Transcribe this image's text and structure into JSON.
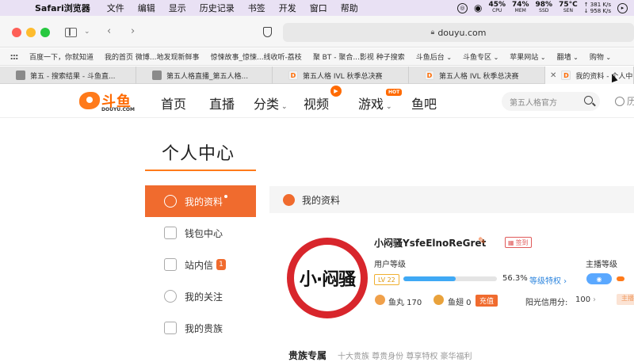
{
  "menubar": {
    "apple": "",
    "app": "Safari浏览器",
    "items": [
      "文件",
      "编辑",
      "显示",
      "历史记录",
      "书签",
      "开发",
      "窗口",
      "帮助"
    ],
    "stats": [
      {
        "value": "45%",
        "label": "CPU"
      },
      {
        "value": "74%",
        "label": "MEM"
      },
      {
        "value": "98%",
        "label": "SSD"
      },
      {
        "value": "75°C",
        "label": "SEN"
      }
    ],
    "net_up": "↑ 381 K/s",
    "net_down": "↓ 958 K/s"
  },
  "toolbar": {
    "url": "douyu.com"
  },
  "bookmarks": [
    {
      "label": "百度一下，你就知道",
      "folder": false
    },
    {
      "label": "我的首页 微博...地发现新鲜事",
      "folder": false
    },
    {
      "label": "惊悚故事_惊悚...线收听-荔枝",
      "folder": false
    },
    {
      "label": "聚 BT - 聚合...影视 种子搜索",
      "folder": false
    },
    {
      "label": "斗鱼后台",
      "folder": true
    },
    {
      "label": "斗鱼专区",
      "folder": true
    },
    {
      "label": "苹果网站",
      "folder": true
    },
    {
      "label": "翻墙",
      "folder": true
    },
    {
      "label": "购物",
      "folder": true
    }
  ],
  "tabs": [
    {
      "label": "第五 - 搜索结果 - 斗鱼直...",
      "icon": ""
    },
    {
      "label": "第五人格直播_第五人格...",
      "icon": ""
    },
    {
      "label": "第五人格 IVL 秋季总决赛",
      "icon": "D"
    },
    {
      "label": "第五人格 IVL 秋季总决赛",
      "icon": "D"
    },
    {
      "label": "我的资料 - 个人中",
      "icon": "D"
    }
  ],
  "nav": {
    "logo_text": "斗鱼",
    "logo_sub": "DOUYU.COM",
    "items": [
      "首页",
      "直播",
      "分类",
      "视频",
      "游戏",
      "鱼吧"
    ],
    "hot_badge": "HOT",
    "search_placeholder": "第五人格官方",
    "history": "历"
  },
  "page": {
    "title": "个人中心",
    "sidebar": [
      {
        "label": "我的资料",
        "active": true
      },
      {
        "label": "钱包中心",
        "active": false
      },
      {
        "label": "站内信",
        "active": false,
        "count": "1"
      },
      {
        "label": "我的关注",
        "active": false
      },
      {
        "label": "我的贵族",
        "active": false
      }
    ],
    "section_title": "我的资料"
  },
  "profile": {
    "avatar_text": "小·闷骚",
    "username": "小闷骚YsfeElnoReGret",
    "signin": "签到",
    "user_level_label": "用户等级",
    "level_badge": "LV 22",
    "progress": 0.563,
    "progress_text": "56.3%",
    "privilege_link": "等级特权",
    "fish_balls": "鱼丸 170",
    "fish_fins": "鱼翅 0",
    "recharge": "充值",
    "credit_label": "阳光信用分:",
    "credit_value": "100",
    "anchor_level_label": "主播等级",
    "anchor_badge": "主播"
  },
  "noble": {
    "title": "贵族专属",
    "desc": "十大贵族 尊贵身份 尊享特权 豪华福利"
  }
}
